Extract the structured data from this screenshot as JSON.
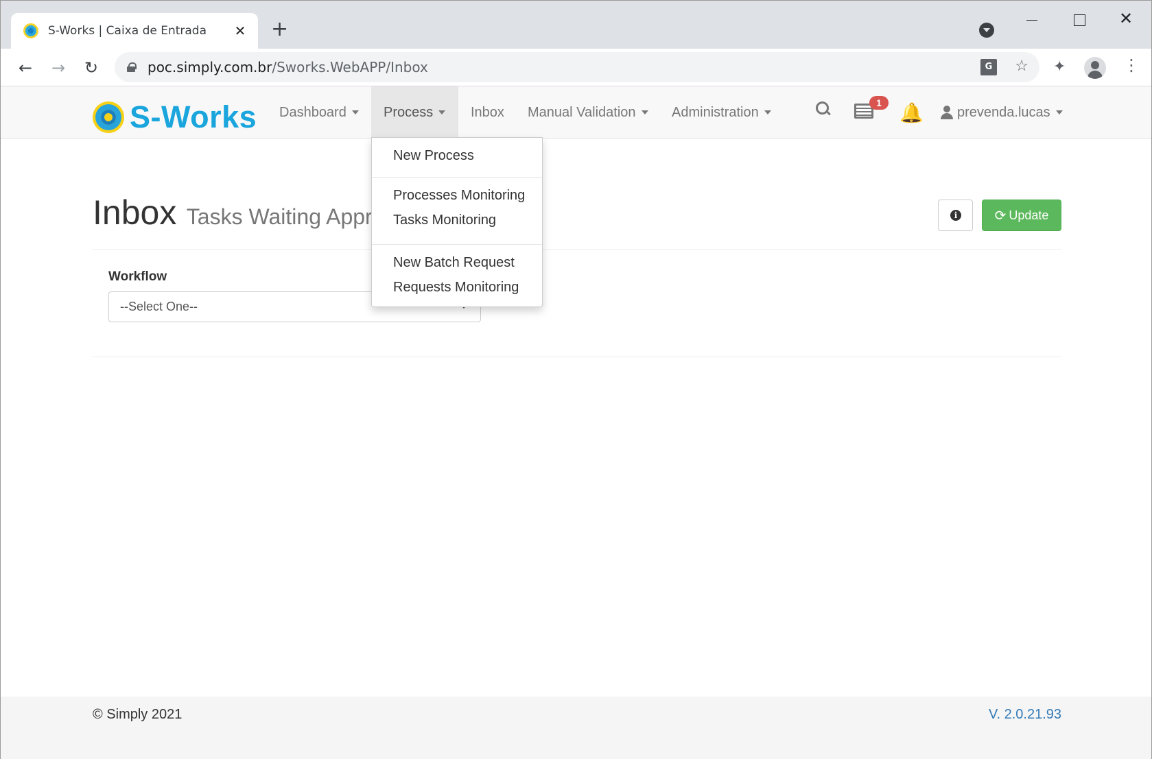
{
  "browser": {
    "tab_title": "S-Works | Caixa de Entrada",
    "tab_close": "✕",
    "new_tab": "+",
    "url_host": "poc.simply.com.br",
    "url_path": "/Sworks.WebAPP/Inbox",
    "back_glyph": "←",
    "forward_glyph": "→",
    "reload_glyph": "↻",
    "star_glyph": "☆",
    "extensions_glyph": "✦",
    "menu_glyph": "⋮",
    "close_glyph": "✕"
  },
  "navbar": {
    "brand": "S-Works",
    "items": [
      {
        "label": "Dashboard",
        "has_caret": true
      },
      {
        "label": "Process",
        "has_caret": true,
        "active": true
      },
      {
        "label": "Inbox",
        "has_caret": false
      },
      {
        "label": "Manual Validation",
        "has_caret": true
      },
      {
        "label": "Administration",
        "has_caret": true
      }
    ],
    "tasks_badge": "1",
    "bell_glyph": "🔔",
    "username": "prevenda.lucas"
  },
  "process_menu": {
    "items": [
      "New Process",
      "Processes Monitoring",
      "Tasks Monitoring",
      "New Batch Request",
      "Requests Monitoring"
    ]
  },
  "page": {
    "title": "Inbox",
    "subtitle": "Tasks Waiting Appr",
    "info_glyph": "i",
    "update_label": "Update",
    "refresh_glyph": "⟳",
    "workflow_label": "Workflow",
    "workflow_value": "--Select One--"
  },
  "footer": {
    "copyright": "© Simply 2021",
    "version": "V. 2.0.21.93"
  },
  "colors": {
    "brand_blue": "#1aa5dd",
    "brand_yellow": "#f7d117",
    "update_green": "#5cb85c",
    "badge_red": "#d9534f",
    "version_link": "#337ab7"
  }
}
